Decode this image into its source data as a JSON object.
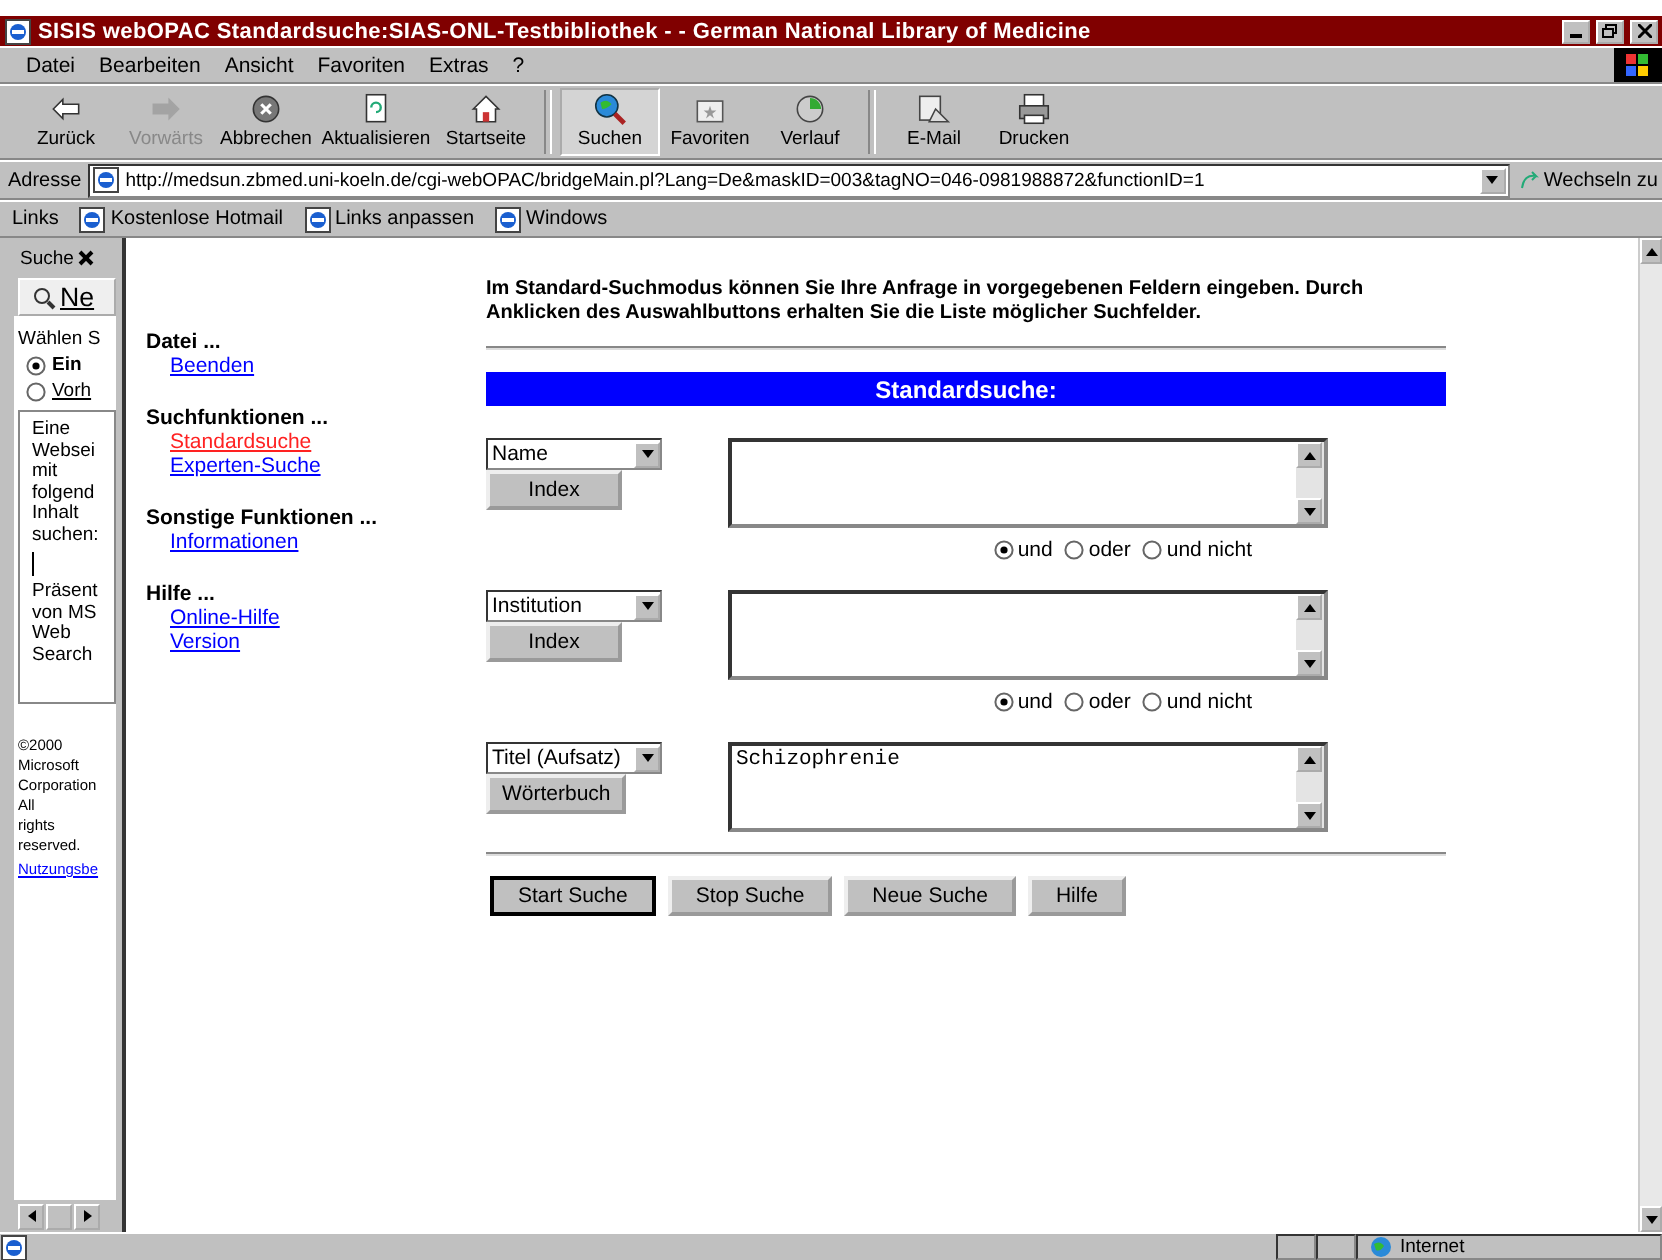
{
  "window": {
    "title": "SISIS webOPAC Standardsuche:SIAS-ONL-Testbibliothek - - German National Library of Medicine"
  },
  "menu": [
    "Datei",
    "Bearbeiten",
    "Ansicht",
    "Favoriten",
    "Extras",
    "?"
  ],
  "toolbar": [
    {
      "label": "Zurück",
      "disabled": false,
      "selected": false
    },
    {
      "label": "Vorwärts",
      "disabled": true,
      "selected": false
    },
    {
      "label": "Abbrechen",
      "disabled": false,
      "selected": false
    },
    {
      "label": "Aktualisieren",
      "disabled": false,
      "selected": false
    },
    {
      "label": "Startseite",
      "disabled": false,
      "selected": false
    },
    {
      "label": "Suchen",
      "disabled": false,
      "selected": true
    },
    {
      "label": "Favoriten",
      "disabled": false,
      "selected": false
    },
    {
      "label": "Verlauf",
      "disabled": false,
      "selected": false
    },
    {
      "label": "E-Mail",
      "disabled": false,
      "selected": false
    },
    {
      "label": "Drucken",
      "disabled": false,
      "selected": false
    }
  ],
  "address": {
    "label": "Adresse",
    "url": "http://medsun.zbmed.uni-koeln.de/cgi-webOPAC/bridgeMain.pl?Lang=De&maskID=003&tagNO=046-0981988872&functionID=1",
    "go": "Wechseln zu"
  },
  "links": {
    "label": "Links",
    "items": [
      "Kostenlose Hotmail",
      "Links anpassen",
      "Windows"
    ]
  },
  "search_pane": {
    "title": "Suche",
    "tool": "Ne",
    "heading": "Wählen S",
    "options": [
      {
        "label": "Ein",
        "selected": true
      },
      {
        "label": "Vorh",
        "selected": false
      }
    ],
    "box_lines": [
      "Eine",
      "Websei",
      "mit",
      "folgend",
      "Inhalt",
      "suchen:"
    ],
    "credit_lines": [
      "Präsent",
      "von MS",
      "Web",
      "Search"
    ],
    "copyright_lines": [
      "©2000",
      "Microsoft",
      "Corporation",
      "All",
      "rights",
      "reserved."
    ],
    "terms_link": "Nutzungsbe"
  },
  "nav": [
    {
      "heading": "Datei ...",
      "links": [
        {
          "label": "Beenden",
          "selected": false
        }
      ]
    },
    {
      "heading": "Suchfunktionen ...",
      "links": [
        {
          "label": "Standardsuche",
          "selected": true
        },
        {
          "label": "Experten-Suche",
          "selected": false
        }
      ]
    },
    {
      "heading": "Sonstige Funktionen ...",
      "links": [
        {
          "label": "Informationen",
          "selected": false
        }
      ]
    },
    {
      "heading": "Hilfe ...",
      "links": [
        {
          "label": "Online-Hilfe",
          "selected": false
        },
        {
          "label": "Version",
          "selected": false
        }
      ]
    }
  ],
  "intro": "Im Standard-Suchmodus können Sie Ihre Anfrage in vorgegebenen Feldern eingeben. Durch Anklicken des Auswahlbuttons erhalten Sie die Liste möglicher Suchfelder.",
  "banner": "Standardsuche:",
  "rows": [
    {
      "field": "Name",
      "button": "Index",
      "value": "",
      "operators": [
        {
          "label": "und",
          "selected": true
        },
        {
          "label": "oder",
          "selected": false
        },
        {
          "label": "und nicht",
          "selected": false
        }
      ]
    },
    {
      "field": "Institution",
      "button": "Index",
      "value": "",
      "operators": [
        {
          "label": "und",
          "selected": true
        },
        {
          "label": "oder",
          "selected": false
        },
        {
          "label": "und nicht",
          "selected": false
        }
      ]
    },
    {
      "field": "Titel (Aufsatz)",
      "button": "Wörterbuch",
      "value": "Schizophrenie"
    }
  ],
  "buttons": [
    "Start Suche",
    "Stop Suche",
    "Neue Suche",
    "Hilfe"
  ],
  "status_bar": {
    "zone": "Internet"
  }
}
